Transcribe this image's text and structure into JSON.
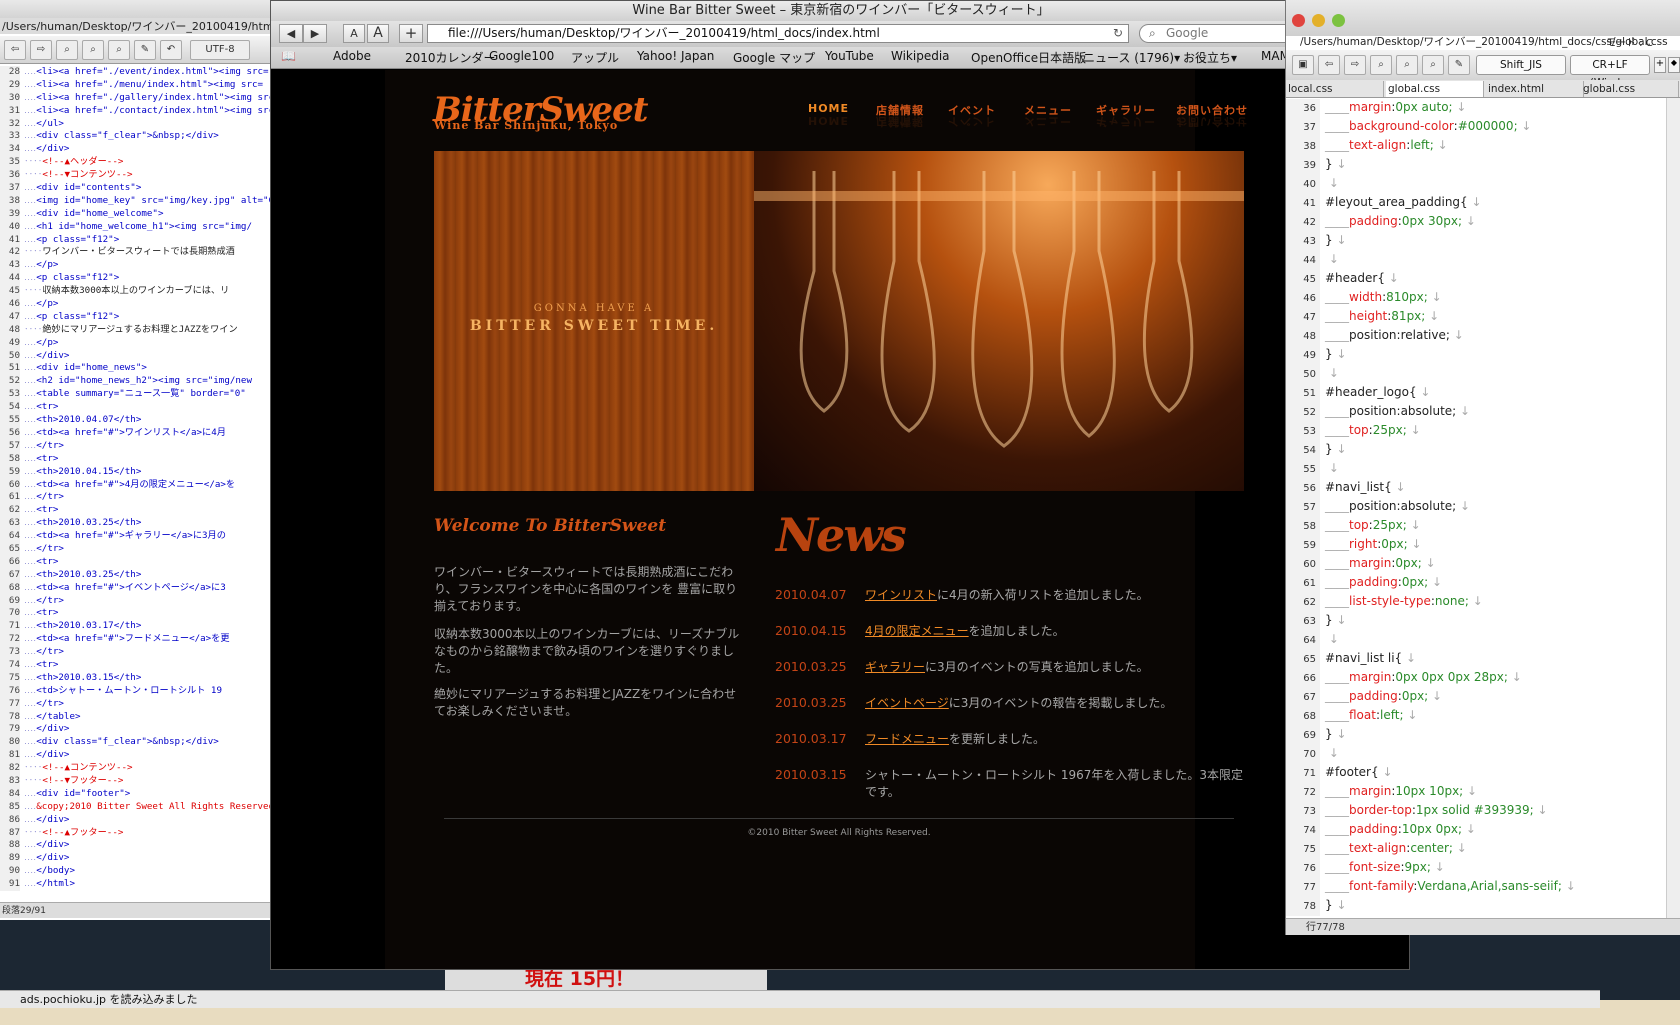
{
  "left_editor": {
    "path": "/Users/human/Desktop/ワインバー_20100419/html_docs/inde",
    "encoding": "UTF-8",
    "status": "段落29/91",
    "lines": [
      {
        "n": "28",
        "t": "<li><a href=\"./event/index.html\"><img src=",
        "k": "tag"
      },
      {
        "n": "29",
        "t": "<li><a href=\"./menu/index.html\"><img src=",
        "k": "tag"
      },
      {
        "n": "30",
        "t": "<li><a href=\"./gallery/index.html\"><img src=",
        "k": "tag"
      },
      {
        "n": "31",
        "t": "<li><a href=\"./contact/index.html\"><img src=",
        "k": "tag"
      },
      {
        "n": "32",
        "t": "</ul>",
        "k": "tag"
      },
      {
        "n": "33",
        "t": "<div class=\"f_clear\">&nbsp;</div>",
        "k": "tag"
      },
      {
        "n": "34",
        "t": "</div>",
        "k": "tag"
      },
      {
        "n": "35",
        "t": "<!--▲ヘッダー-->",
        "k": "comment"
      },
      {
        "n": "36",
        "t": "<!--▼コンテンツ-->",
        "k": "comment"
      },
      {
        "n": "37",
        "t": "<div id=\"contents\">",
        "k": "tag"
      },
      {
        "n": "38",
        "t": "<img id=\"home_key\" src=\"img/key.jpg\" alt=\"Go",
        "k": "tag"
      },
      {
        "n": "39",
        "t": "<div id=\"home_welcome\">",
        "k": "tag"
      },
      {
        "n": "40",
        "t": "<h1 id=\"home_welcome_h1\"><img src=\"img/",
        "k": "tag"
      },
      {
        "n": "41",
        "t": "<p class=\"f12\">",
        "k": "tag"
      },
      {
        "n": "42",
        "t": "ワインバー・ビタースウィートでは長期熟成酒",
        "k": "text"
      },
      {
        "n": "43",
        "t": "</p>",
        "k": "tag"
      },
      {
        "n": "44",
        "t": "<p class=\"f12\">",
        "k": "tag"
      },
      {
        "n": "45",
        "t": "収納本数3000本以上のワインカーブには、リ",
        "k": "text"
      },
      {
        "n": "46",
        "t": "</p>",
        "k": "tag"
      },
      {
        "n": "47",
        "t": "<p class=\"f12\">",
        "k": "tag"
      },
      {
        "n": "48",
        "t": "絶妙にマリアージュするお料理とJAZZをワイン",
        "k": "text"
      },
      {
        "n": "49",
        "t": "</p>",
        "k": "tag"
      },
      {
        "n": "50",
        "t": "</div>",
        "k": "tag"
      },
      {
        "n": "51",
        "t": "<div id=\"home_news\">",
        "k": "tag"
      },
      {
        "n": "52",
        "t": "<h2 id=\"home_news_h2\"><img src=\"img/new",
        "k": "tag"
      },
      {
        "n": "53",
        "t": "<table summary=\"ニュース一覧\" border=\"0\"",
        "k": "tag"
      },
      {
        "n": "54",
        "t": "<tr>",
        "k": "tag"
      },
      {
        "n": "55",
        "t": "<th>2010.04.07</th>",
        "k": "tag"
      },
      {
        "n": "56",
        "t": "<td><a href=\"#\">ワインリスト</a>に4月",
        "k": "tag"
      },
      {
        "n": "57",
        "t": "</tr>",
        "k": "tag"
      },
      {
        "n": "58",
        "t": "<tr>",
        "k": "tag"
      },
      {
        "n": "59",
        "t": "<th>2010.04.15</th>",
        "k": "tag"
      },
      {
        "n": "60",
        "t": "<td><a href=\"#\">4月の限定メニュー</a>を",
        "k": "tag"
      },
      {
        "n": "61",
        "t": "</tr>",
        "k": "tag"
      },
      {
        "n": "62",
        "t": "<tr>",
        "k": "tag"
      },
      {
        "n": "63",
        "t": "<th>2010.03.25</th>",
        "k": "tag"
      },
      {
        "n": "64",
        "t": "<td><a href=\"#\">ギャラリー</a>に3月の",
        "k": "tag"
      },
      {
        "n": "65",
        "t": "</tr>",
        "k": "tag"
      },
      {
        "n": "66",
        "t": "<tr>",
        "k": "tag"
      },
      {
        "n": "67",
        "t": "<th>2010.03.25</th>",
        "k": "tag"
      },
      {
        "n": "68",
        "t": "<td><a href=\"#\">イベントページ</a>に3",
        "k": "tag"
      },
      {
        "n": "69",
        "t": "</tr>",
        "k": "tag"
      },
      {
        "n": "70",
        "t": "<tr>",
        "k": "tag"
      },
      {
        "n": "71",
        "t": "<th>2010.03.17</th>",
        "k": "tag"
      },
      {
        "n": "72",
        "t": "<td><a href=\"#\">フードメニュー</a>を更",
        "k": "tag"
      },
      {
        "n": "73",
        "t": "</tr>",
        "k": "tag"
      },
      {
        "n": "74",
        "t": "<tr>",
        "k": "tag"
      },
      {
        "n": "75",
        "t": "<th>2010.03.15</th>",
        "k": "tag"
      },
      {
        "n": "76",
        "t": "<td>シャトー・ムートン・ロートシルト 19",
        "k": "tag"
      },
      {
        "n": "77",
        "t": "</tr>",
        "k": "tag"
      },
      {
        "n": "78",
        "t": "</table>",
        "k": "tag"
      },
      {
        "n": "79",
        "t": "</div>",
        "k": "tag"
      },
      {
        "n": "80",
        "t": "<div class=\"f_clear\">&nbsp;</div>",
        "k": "tag"
      },
      {
        "n": "81",
        "t": "</div>",
        "k": "tag"
      },
      {
        "n": "82",
        "t": "<!--▲コンテンツ-->",
        "k": "comment"
      },
      {
        "n": "83",
        "t": "<!--▼フッター-->",
        "k": "comment"
      },
      {
        "n": "84",
        "t": "<div id=\"footer\">",
        "k": "tag"
      },
      {
        "n": "85",
        "t": "&copy;2010 Bitter Sweet All Rights Reserved.",
        "k": "comment"
      },
      {
        "n": "86",
        "t": "</div>",
        "k": "tag"
      },
      {
        "n": "87",
        "t": "<!--▲フッター-->",
        "k": "comment"
      },
      {
        "n": "88",
        "t": "</div>",
        "k": "tag"
      },
      {
        "n": "89",
        "t": "</div>",
        "k": "tag"
      },
      {
        "n": "90",
        "t": "</body>",
        "k": "tag"
      },
      {
        "n": "91",
        "t": "</html>",
        "k": "tag"
      }
    ]
  },
  "browser": {
    "title": "Wine Bar Bitter Sweet – 東京新宿のワインバー「ビタースウィート」",
    "url": "file:///Users/human/Desktop/ワインバー_20100419/html_docs/index.html",
    "search_placeholder": "Google",
    "font_small": "A",
    "font_large": "A",
    "add": "+",
    "bookmarks": [
      "Adobe",
      "2010カレンダー",
      "Google100",
      "アップル",
      "Yahoo! Japan",
      "Google マップ",
      "YouTube",
      "Wikipedia",
      "OpenOffice日本語版",
      "ニュース (1796)▾",
      "お役立ち▾",
      "MAMP"
    ],
    "status": "ads.pochioku.jp を読み込みました"
  },
  "site": {
    "logo_main": "BitterSweet",
    "logo_sub": "Wine Bar Shinjuku, Tokyo",
    "nav": [
      "HOME",
      "店舗情報",
      "イベント",
      "メニュー",
      "ギャラリー",
      "お問い合わせ"
    ],
    "hero_tag1": "GONNA HAVE A",
    "hero_tag2": "BITTER SWEET TIME.",
    "welcome_title": "Welcome To BitterSweet",
    "welcome_p1": "ワインバー・ビタースウィートでは長期熟成酒にこだわり、フランスワインを中心に各国のワインを 豊富に取り揃えております。",
    "welcome_p2": "収納本数3000本以上のワインカーブには、リーズナブルなものから銘醸物まで飲み頃のワインを選りすぐりました。",
    "welcome_p3": "絶妙にマリアージュするお料理とJAZZをワインに合わせてお楽しみくださいませ。",
    "news_title": "News",
    "news": [
      {
        "date": "2010.04.07",
        "link": "ワインリスト",
        "rest": "に4月の新入荷リストを追加しました。"
      },
      {
        "date": "2010.04.15",
        "link": "4月の限定メニュー",
        "rest": "を追加しました。"
      },
      {
        "date": "2010.03.25",
        "link": "ギャラリー",
        "rest": "に3月のイベントの写真を追加しました。"
      },
      {
        "date": "2010.03.25",
        "link": "イベントページ",
        "rest": "に3月のイベントの報告を掲載しました。"
      },
      {
        "date": "2010.03.17",
        "link": "フードメニュー",
        "rest": "を更新しました。"
      },
      {
        "date": "2010.03.15",
        "link": "",
        "rest": "シャトー・ムートン・ロートシルト 1967年を入荷しました。3本限定です。"
      }
    ],
    "footer": "©2010 Bitter Sweet All Rights Reserved."
  },
  "right_editor": {
    "path": "/Users/human/Desktop/ワインバー_20100419/html_docs/css/global.css",
    "mode": "モード : C",
    "encoding": "Shift_JIS",
    "linebreak": "CR+LF (Wind...",
    "tabs": [
      "local.css",
      "global.css",
      "index.html",
      "global.css"
    ],
    "status": "行77/78",
    "lines": [
      {
        "n": "36",
        "p": "margin",
        "v": "0px auto;",
        "ind": true
      },
      {
        "n": "37",
        "p": "background-color",
        "v": "#000000;",
        "ind": true
      },
      {
        "n": "38",
        "p": "text-align",
        "v": "left;",
        "ind": true
      },
      {
        "n": "39",
        "t": "}"
      },
      {
        "n": "40",
        "t": ""
      },
      {
        "n": "41",
        "t": "#leyout_area_padding{"
      },
      {
        "n": "42",
        "p": "padding",
        "v": "0px 30px;",
        "ind": true
      },
      {
        "n": "43",
        "t": "}"
      },
      {
        "n": "44",
        "t": ""
      },
      {
        "n": "45",
        "t": "#header{"
      },
      {
        "n": "46",
        "p": "width",
        "v": "810px;",
        "ind": true
      },
      {
        "n": "47",
        "p": "height",
        "v": "81px;",
        "ind": true
      },
      {
        "n": "48",
        "t": "position:relative;",
        "ind": true
      },
      {
        "n": "49",
        "t": "}"
      },
      {
        "n": "50",
        "t": ""
      },
      {
        "n": "51",
        "t": "#header_logo{"
      },
      {
        "n": "52",
        "t": "position:absolute;",
        "ind": true
      },
      {
        "n": "53",
        "p": "top",
        "v": "25px;",
        "ind": true
      },
      {
        "n": "54",
        "t": "}"
      },
      {
        "n": "55",
        "t": ""
      },
      {
        "n": "56",
        "t": "#navi_list{"
      },
      {
        "n": "57",
        "t": "position:absolute;",
        "ind": true
      },
      {
        "n": "58",
        "p": "top",
        "v": "25px;",
        "ind": true
      },
      {
        "n": "59",
        "p": "right",
        "v": "0px;",
        "ind": true
      },
      {
        "n": "60",
        "p": "margin",
        "v": "0px;",
        "ind": true
      },
      {
        "n": "61",
        "p": "padding",
        "v": "0px;",
        "ind": true
      },
      {
        "n": "62",
        "p": "list-style-type",
        "v": "none;",
        "ind": true
      },
      {
        "n": "63",
        "t": "}"
      },
      {
        "n": "64",
        "t": ""
      },
      {
        "n": "65",
        "t": "#navi_list li{"
      },
      {
        "n": "66",
        "p": "margin",
        "v": "0px 0px 0px 28px;",
        "ind": true
      },
      {
        "n": "67",
        "p": "padding",
        "v": "0px;",
        "ind": true
      },
      {
        "n": "68",
        "p": "float",
        "v": "left;",
        "ind": true
      },
      {
        "n": "69",
        "t": "}"
      },
      {
        "n": "70",
        "t": ""
      },
      {
        "n": "71",
        "t": "#footer{"
      },
      {
        "n": "72",
        "p": "margin",
        "v": "10px 10px;",
        "ind": true
      },
      {
        "n": "73",
        "p": "border-top",
        "v": "1px solid #393939;",
        "ind": true
      },
      {
        "n": "74",
        "p": "padding",
        "v": "10px 0px;",
        "ind": true
      },
      {
        "n": "75",
        "p": "text-align",
        "v": "center;",
        "ind": true
      },
      {
        "n": "76",
        "p": "font-size",
        "v": "9px;",
        "ind": true
      },
      {
        "n": "77",
        "p": "font-family",
        "v": "Verdana,Arial,sans-seiif;",
        "ind": true
      },
      {
        "n": "78",
        "t": "}"
      }
    ]
  },
  "banner": "現在 15円！",
  "colors": {
    "accent": "#e8661a",
    "news_date": "#c44416",
    "link": "#f08a26"
  }
}
